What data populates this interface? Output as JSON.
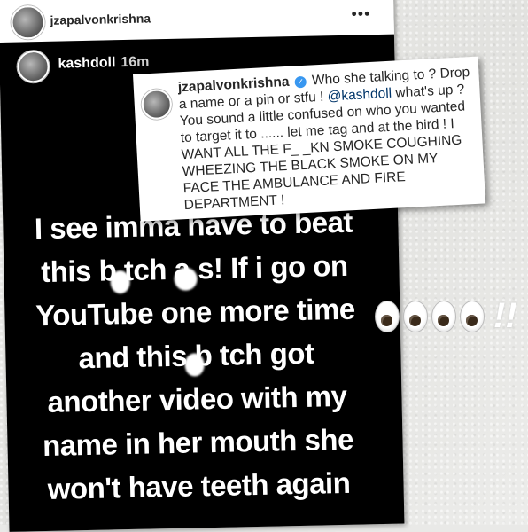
{
  "post": {
    "username": "jzapalvonkrishna",
    "more_icon": "more-horizontal-icon"
  },
  "story": {
    "username": "kashdoll",
    "time": "16m",
    "lines": [
      "I see imma have to beat",
      "this b tch a s! If i go on",
      "YouTube one more time",
      "and this b tch got",
      "another video with my",
      "name in her mouth she",
      "won't have teeth again"
    ]
  },
  "comment": {
    "username": "jzapalvonkrishna",
    "text_1": "Who she talking to ? Drop a name or a pin or stfu ! ",
    "mention": "@kashdoll",
    "text_2": " what's up ? You sound a little confused on who you wanted to target it to ...... let me tag and at the bird ! I WANT ALL THE F_ _KN SMOKE COUGHING WHEEZING THE BLACK SMOKE ON MY FACE THE AMBULANCE AND FIRE DEPARTMENT !"
  },
  "overlay": {
    "emoji": "eyes-emoji",
    "bangs": "!!"
  }
}
